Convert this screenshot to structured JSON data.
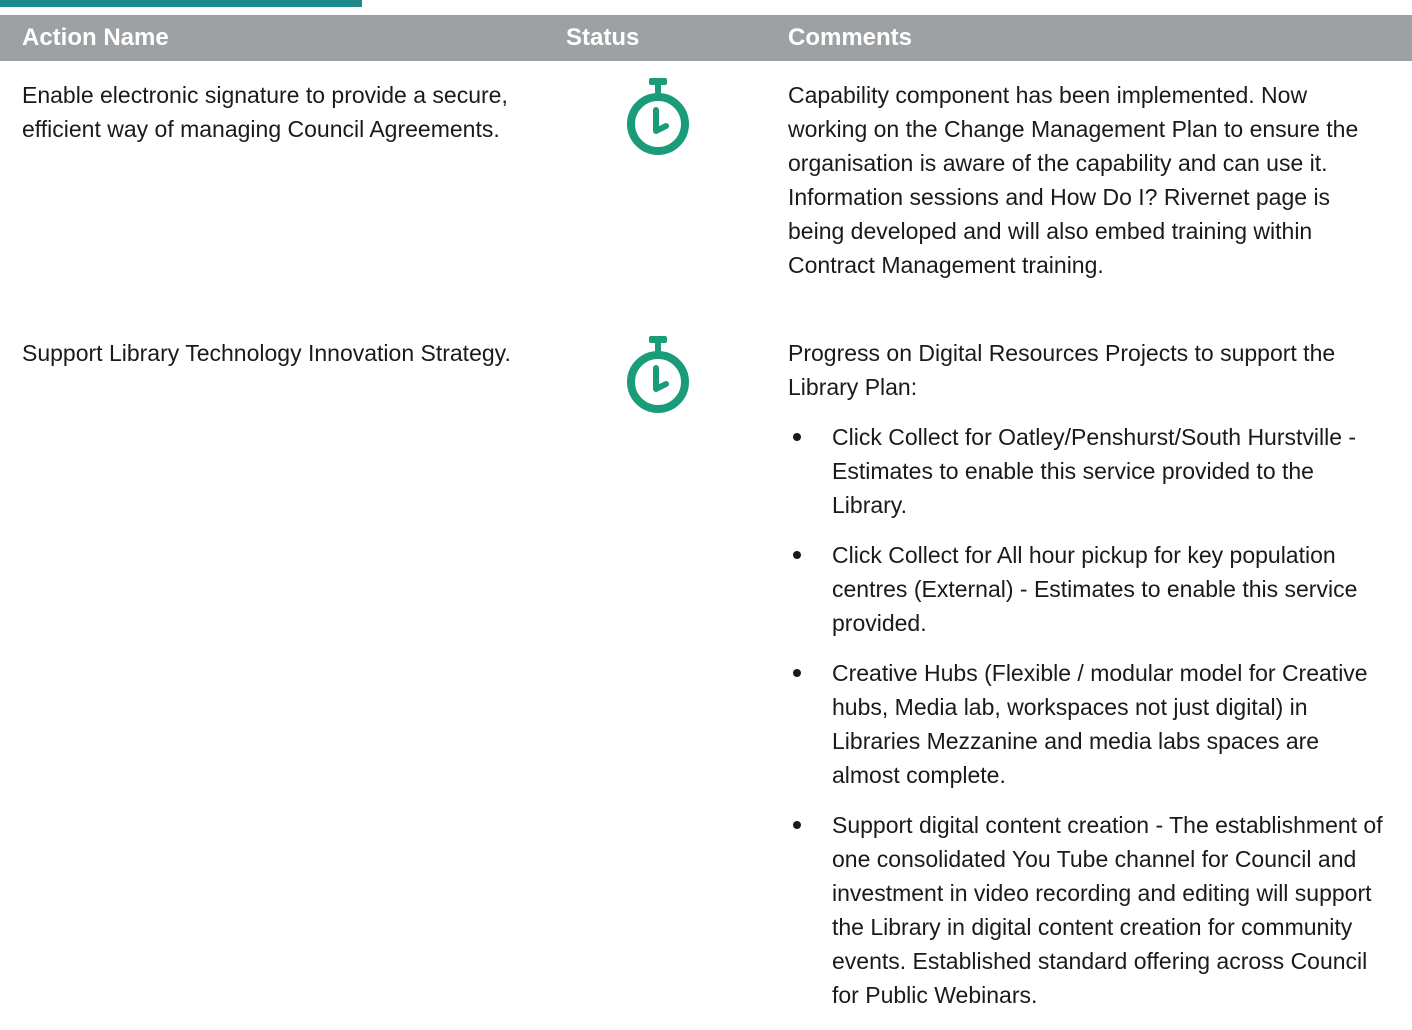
{
  "colors": {
    "accent": "#1e8a8a",
    "header_bg": "#9ea1a3",
    "status_icon": "#1a9b7a"
  },
  "header": {
    "action_name": "Action Name",
    "status": "Status",
    "comments": "Comments"
  },
  "rows": [
    {
      "action": "Enable electronic signature to provide a secure, efficient way of managing Council Agreements.",
      "status_icon": "stopwatch-icon",
      "comments": "Capability component has been implemented. Now working on the Change Management Plan to ensure the organisation is aware of the capability and can use it.  Information sessions and How Do I? Rivernet page is being developed and will also embed training within Contract Management training."
    },
    {
      "action": "Support Library Technology Innovation Strategy.",
      "status_icon": "stopwatch-icon",
      "comments_intro": "Progress on Digital Resources Projects to support the Library Plan:",
      "bullets": [
        "Click Collect for Oatley/Penshurst/South Hurstville - Estimates to enable this service provided to the Library.",
        "Click Collect for All hour pickup for key population centres (External) - Estimates to enable this service provided.",
        "Creative Hubs (Flexible / modular model for Creative hubs, Media lab, workspaces not just digital) in Libraries Mezzanine and media labs spaces are almost complete.",
        "Support digital content creation - The establishment of one consolidated You Tube channel for Council and investment in video recording and editing will support the Library in digital content creation for community events. Established standard offering across Council for Public Webinars."
      ]
    }
  ]
}
